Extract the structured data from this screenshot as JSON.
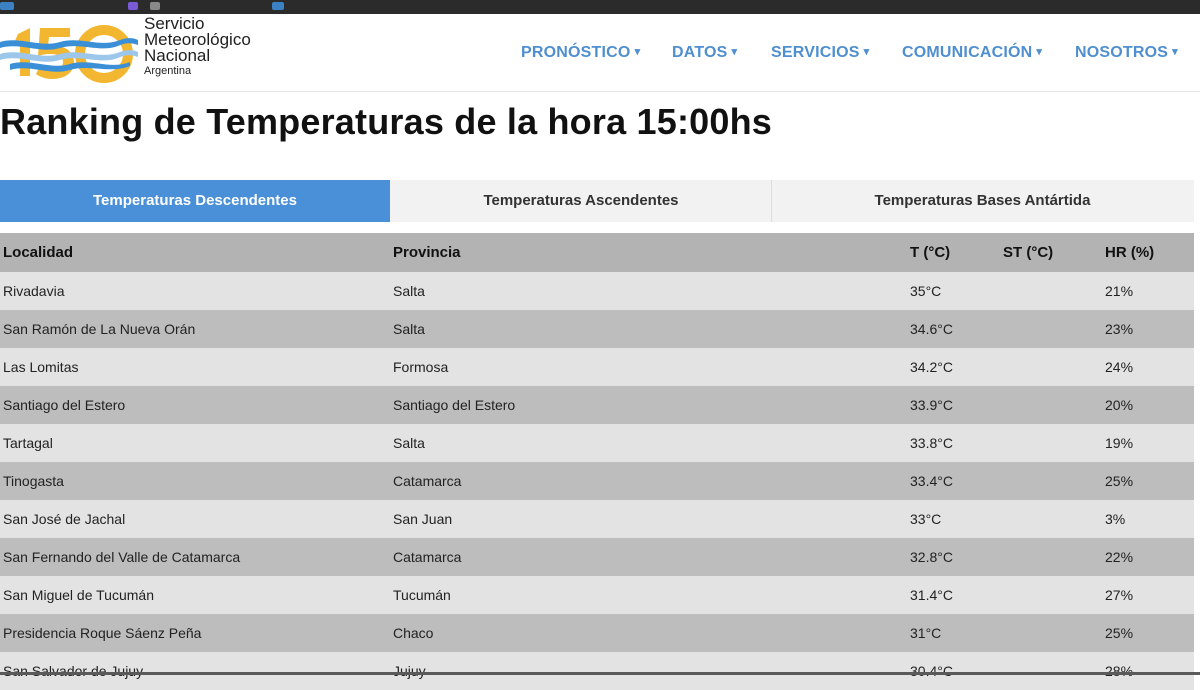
{
  "header": {
    "logo_lines": [
      "Servicio",
      "Meteorológico",
      "Nacional",
      "Argentina"
    ],
    "logo_mark": "15O",
    "nav": [
      {
        "label": "PRONÓSTICO"
      },
      {
        "label": "DATOS"
      },
      {
        "label": "SERVICIOS"
      },
      {
        "label": "COMUNICACIÓN"
      },
      {
        "label": "NOSOTROS"
      }
    ]
  },
  "title": "Ranking de Temperaturas de la hora 15:00hs",
  "tabs": [
    {
      "label": "Temperaturas Descendentes",
      "active": true
    },
    {
      "label": "Temperaturas Ascendentes",
      "active": false
    },
    {
      "label": "Temperaturas Bases Antártida",
      "active": false
    }
  ],
  "table": {
    "columns": [
      "Localidad",
      "Provincia",
      "T (°C)",
      "ST (°C)",
      "HR (%)"
    ],
    "rows": [
      {
        "localidad": "Rivadavia",
        "provincia": "Salta",
        "t": "35°C",
        "st": "",
        "hr": "21%"
      },
      {
        "localidad": "San Ramón de La Nueva Orán",
        "provincia": "Salta",
        "t": "34.6°C",
        "st": "",
        "hr": "23%"
      },
      {
        "localidad": "Las Lomitas",
        "provincia": "Formosa",
        "t": "34.2°C",
        "st": "",
        "hr": "24%"
      },
      {
        "localidad": "Santiago del Estero",
        "provincia": "Santiago del Estero",
        "t": "33.9°C",
        "st": "",
        "hr": "20%"
      },
      {
        "localidad": "Tartagal",
        "provincia": "Salta",
        "t": "33.8°C",
        "st": "",
        "hr": "19%"
      },
      {
        "localidad": "Tinogasta",
        "provincia": "Catamarca",
        "t": "33.4°C",
        "st": "",
        "hr": "25%"
      },
      {
        "localidad": "San José de Jachal",
        "provincia": "San Juan",
        "t": "33°C",
        "st": "",
        "hr": "3%"
      },
      {
        "localidad": "San Fernando del Valle de Catamarca",
        "provincia": "Catamarca",
        "t": "32.8°C",
        "st": "",
        "hr": "22%"
      },
      {
        "localidad": "San Miguel de Tucumán",
        "provincia": "Tucumán",
        "t": "31.4°C",
        "st": "",
        "hr": "27%"
      },
      {
        "localidad": "Presidencia Roque Sáenz Peña",
        "provincia": "Chaco",
        "t": "31°C",
        "st": "",
        "hr": "25%"
      },
      {
        "localidad": "San Salvador de Jujuy",
        "provincia": "Jujuy",
        "t": "30.4°C",
        "st": "",
        "hr": "28%"
      }
    ]
  },
  "colors": {
    "accent": "#4a90d9",
    "nav_text": "#4f8fcf",
    "header_row": "#b3b3b3",
    "row_light": "#e3e3e3",
    "row_dark": "#bdbdbd"
  }
}
